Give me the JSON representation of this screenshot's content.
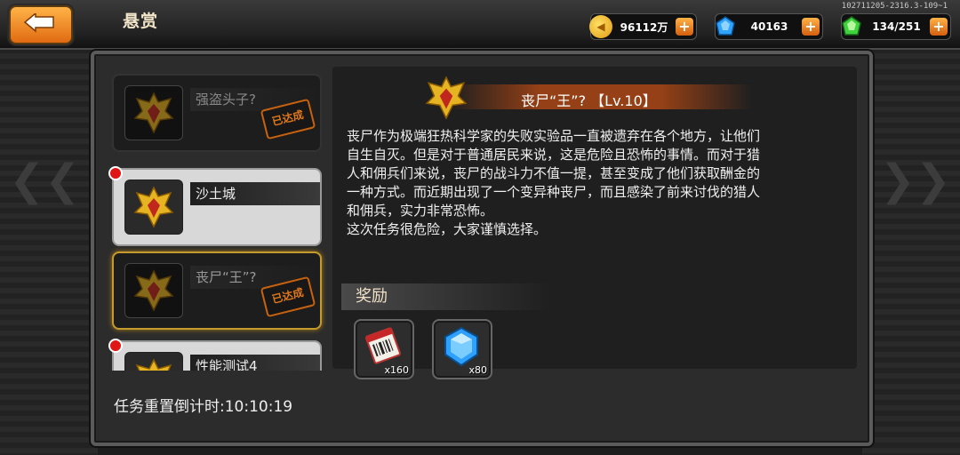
{
  "header": {
    "title": "悬赏",
    "build_id": "102711205-2316.3-109~1"
  },
  "resources": [
    {
      "name": "gold",
      "value": "96112万",
      "icon": "gold-coin-icon",
      "color": "#f2b21b"
    },
    {
      "name": "gem",
      "value": "40163",
      "icon": "blue-gem-icon",
      "color": "#2fa4ff"
    },
    {
      "name": "stamina",
      "value": "134/251",
      "icon": "green-gem-icon",
      "color": "#3fd43f"
    }
  ],
  "quests": [
    {
      "name": "强盗头子?",
      "state": "completed",
      "stamp": "已达成"
    },
    {
      "name": "沙土城",
      "state": "active",
      "stamp": ""
    },
    {
      "name": "丧尸“王”?",
      "state": "completed",
      "stamp": "已达成"
    },
    {
      "name": "性能测试4",
      "state": "active",
      "stamp": ""
    }
  ],
  "countdown": "任务重置倒计时:10:10:19",
  "detail": {
    "title": "丧尸“王”? 【Lv.10】",
    "description_lines": [
      "丧尸作为极端狂热科学家的失败实验品一直被遗弃在各个地方，让他们",
      "自生自灭。但是对于普通居民来说，这是危险且恐怖的事情。而对于猎",
      "人和佣兵们来说，丧尸的战斗力不值一提，甚至变成了他们获取酬金的",
      "一种方式。而近期出现了一个变异种丧尸，而且感染了前来讨伐的猎人",
      "和佣兵，实力非常恐怖。",
      "这次任务很危险，大家谨慎选择。"
    ],
    "reward_label": "奖励",
    "rewards": [
      {
        "icon": "ticket-scroll-icon",
        "qty": "x160"
      },
      {
        "icon": "blue-crystal-icon",
        "qty": "x80"
      }
    ]
  },
  "colors": {
    "accent_orange": "#e06a12",
    "stamp_orange": "#c8620f",
    "emblem_gold": "#e6b422",
    "emblem_red": "#c0281e",
    "selected_border": "#c59a2d"
  }
}
